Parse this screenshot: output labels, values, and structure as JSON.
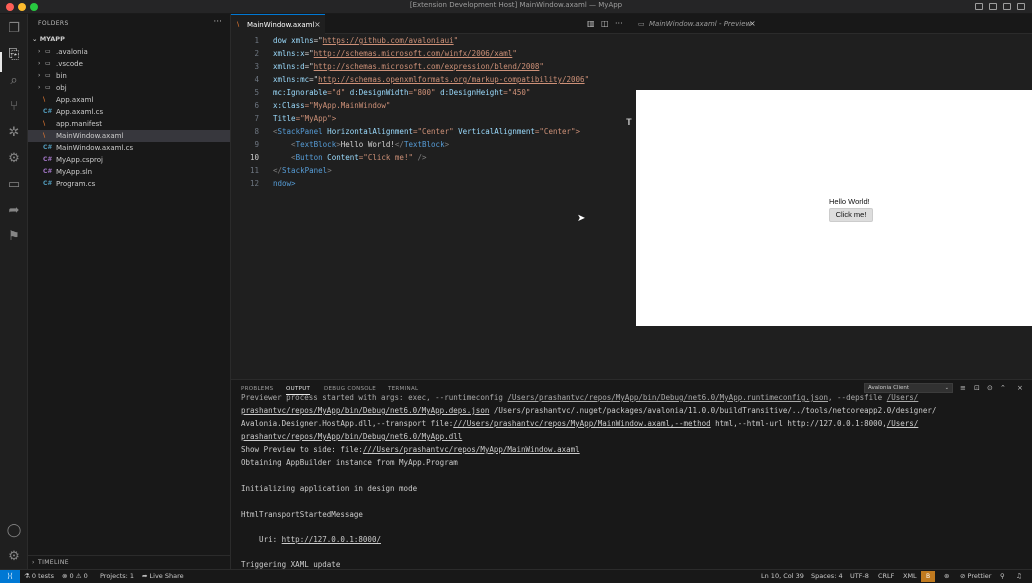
{
  "window": {
    "title": "[Extension Development Host] MainWindow.axaml — MyApp",
    "traffic_colors": [
      "#ff5f57",
      "#febc2e",
      "#28c840"
    ]
  },
  "activity_bar": {
    "icons": [
      "explorer-icon",
      "search-icon",
      "source-control-icon",
      "debug-icon",
      "extensions-icon",
      "remote-explorer-icon",
      "live-share-icon",
      "bookmark-icon",
      "account-icon",
      "settings-gear-icon"
    ]
  },
  "sidebar": {
    "header": "FOLDERS",
    "root": "MYAPP",
    "items": [
      {
        "label": ".avalonia",
        "type": "folder"
      },
      {
        "label": ".vscode",
        "type": "folder"
      },
      {
        "label": "bin",
        "type": "folder"
      },
      {
        "label": "obj",
        "type": "folder"
      },
      {
        "label": "App.axaml",
        "type": "axaml",
        "icon": "\\"
      },
      {
        "label": "App.axaml.cs",
        "type": "cs",
        "icon": "C#"
      },
      {
        "label": "app.manifest",
        "type": "manifest",
        "icon": "\\"
      },
      {
        "label": "MainWindow.axaml",
        "type": "axaml",
        "icon": "\\",
        "selected": true
      },
      {
        "label": "MainWindow.axaml.cs",
        "type": "cs",
        "icon": "C#"
      },
      {
        "label": "MyApp.csproj",
        "type": "csproj",
        "icon": "C#"
      },
      {
        "label": "MyApp.sln",
        "type": "sln",
        "icon": "C#"
      },
      {
        "label": "Program.cs",
        "type": "cs",
        "icon": "C#"
      }
    ],
    "timeline": "TIMELINE"
  },
  "tabs": [
    {
      "label": "MainWindow.axaml",
      "active": true
    },
    {
      "label": "MainWindow.axaml - Preview",
      "active": false
    }
  ],
  "editor": {
    "line_numbers": [
      "1",
      "2",
      "3",
      "4",
      "5",
      "6",
      "7",
      "8",
      "9",
      "10",
      "11",
      "12"
    ],
    "current_line": "10",
    "lines": {
      "l1": {
        "a": "dow ",
        "b": "xmlns",
        "c": "=\"",
        "d": "https://github.com/avaloniaui",
        "e": "\""
      },
      "l2": {
        "a": "xmlns:x",
        "b": "=\"",
        "c": "http://schemas.microsoft.com/winfx/2006/xaml",
        "d": "\""
      },
      "l3": {
        "a": "xmlns:d",
        "b": "=\"",
        "c": "http://schemas.microsoft.com/expression/blend/2008",
        "d": "\""
      },
      "l4": {
        "a": "xmlns:mc",
        "b": "=\"",
        "c": "http://schemas.openxmlformats.org/markup-compatibility/2006",
        "d": "\""
      },
      "l5": {
        "a": "mc:Ignorable",
        "b": "=\"d\" ",
        "c": "d:DesignWidth",
        "d": "=\"800\" ",
        "e": "d:DesignHeight",
        "f": "=\"450\""
      },
      "l6": {
        "a": "x:Class",
        "b": "=\"MyApp.MainWindow\""
      },
      "l7": {
        "a": "Title",
        "b": "=\"MyApp\">"
      },
      "l8": {
        "a": "<",
        "b": "StackPanel",
        "c": " HorizontalAlignment",
        "d": "=\"Center\"",
        "e": " VerticalAlignment",
        "f": "=\"Center\">"
      },
      "l9": {
        "a": "    <",
        "b": "TextBlock",
        "c": ">",
        "d": "Hello World!",
        "e": "</",
        "f": "TextBlock",
        "g": ">"
      },
      "l10": {
        "a": "    <",
        "b": "Button",
        "c": " Content",
        "d": "=\"Click me!\"",
        "e": " />"
      },
      "l11": {
        "a": "</",
        "b": "StackPanel",
        "c": ">"
      },
      "l12": {
        "a": "ndow>"
      }
    }
  },
  "preview": {
    "text": "Hello World!",
    "button": "Click me!"
  },
  "panel": {
    "tabs": [
      "PROBLEMS",
      "OUTPUT",
      "DEBUG CONSOLE",
      "TERMINAL"
    ],
    "active_tab": "OUTPUT",
    "channel": "Avalonia Client",
    "output": {
      "o1a": "Previewer process started with args: exec, --runtimeconfig ",
      "o1b": "/Users/prashantvc/repos/MyApp/bin/Debug/net6.0/MyApp.runtimeconfig.json",
      "o1c": ", --depsfile ",
      "o1d": "/Users/",
      "o2a": "prashantvc/repos/MyApp/bin/Debug/net6.0/MyApp.deps.json",
      "o2b": " /Users/prashantvc/.nuget/packages/avalonia/11.0.0/buildTransitive/../tools/netcoreapp2.0/designer/",
      "o3a": "Avalonia.Designer.HostApp.dll,--transport file:",
      "o3b": "///Users/prashantvc/repos/MyApp/MainWindow.axaml,--method",
      "o3c": " html,--html-url http://127.0.0.1:8000,",
      "o3d": "/Users/",
      "o4a": "prashantvc/repos/MyApp/bin/Debug/net6.0/MyApp.dll",
      "o5a": "Show Preview to side: file:",
      "o5b": "///Users/prashantvc/repos/MyApp/MainWindow.axaml",
      "o6": "Obtaining AppBuilder instance from MyApp.Program",
      "o7": "Initializing application in design mode",
      "o8": "HtmlTransportStartedMessage",
      "o9a": "    Uri: ",
      "o9b": "http://127.0.0.1:8000/",
      "o10": "Triggering XAML update"
    }
  },
  "status": {
    "tests": "0 tests",
    "problems": "⊗ 0 ⚠ 0",
    "projects": "Projects: 1",
    "live_share": "Live Share",
    "position": "Ln 10, Col 39",
    "spaces": "Spaces: 4",
    "encoding": "UTF-8",
    "eol": "CRLF",
    "language": "XML",
    "badge": "B",
    "prettier": "Prettier"
  }
}
